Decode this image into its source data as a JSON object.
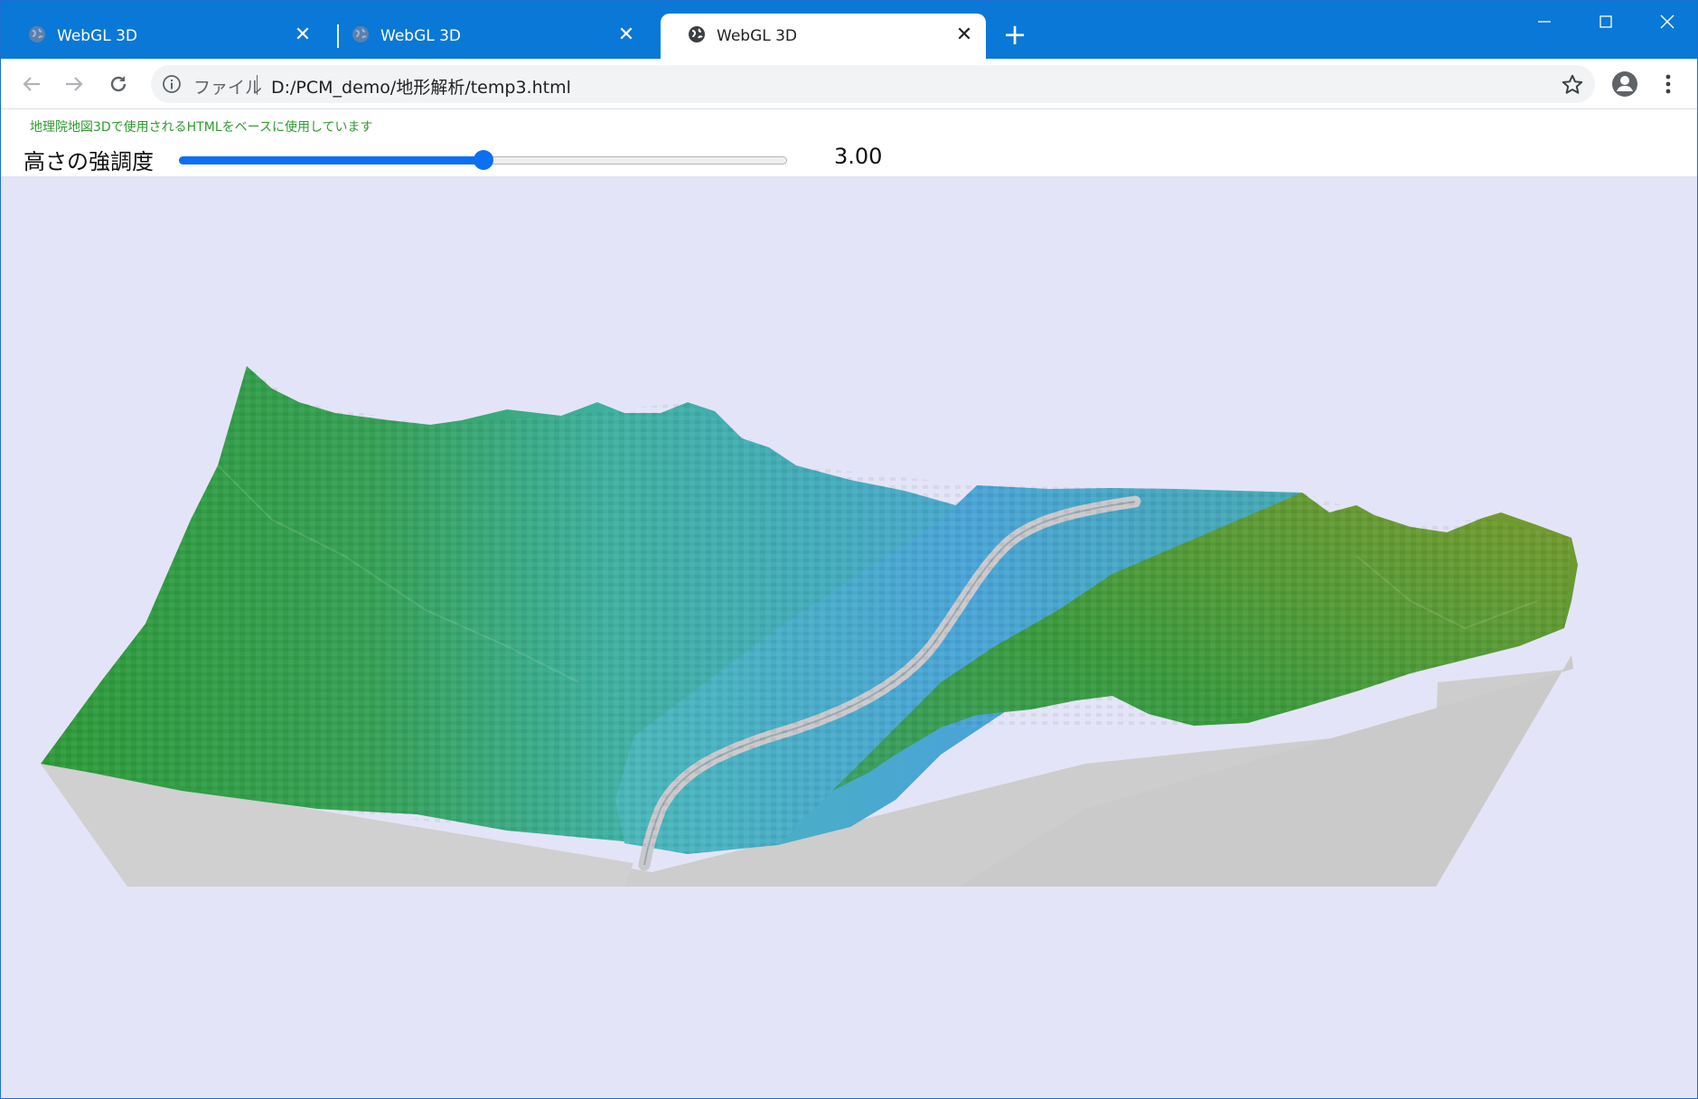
{
  "browser": {
    "tabs": [
      {
        "title": "WebGL 3D",
        "active": false
      },
      {
        "title": "WebGL 3D",
        "active": false
      },
      {
        "title": "WebGL 3D",
        "active": true
      }
    ],
    "address": {
      "scheme_label": "ファイル",
      "url": "D:/PCM_demo/地形解析/temp3.html"
    }
  },
  "page": {
    "credit": "地理院地図3Dで使用されるHTMLをベースに使用しています",
    "slider": {
      "label": "高さの強調度",
      "value_text": "3.00",
      "fraction": 0.5
    }
  },
  "colors": {
    "accent": "#0b6ff2",
    "tabstrip": "#0a78d6",
    "background": "#e4e4f8",
    "terrain_high": "#2f9a3a",
    "terrain_low": "#4aa8d8",
    "river": "#c8c8cc",
    "base": "#cdcdcd"
  }
}
